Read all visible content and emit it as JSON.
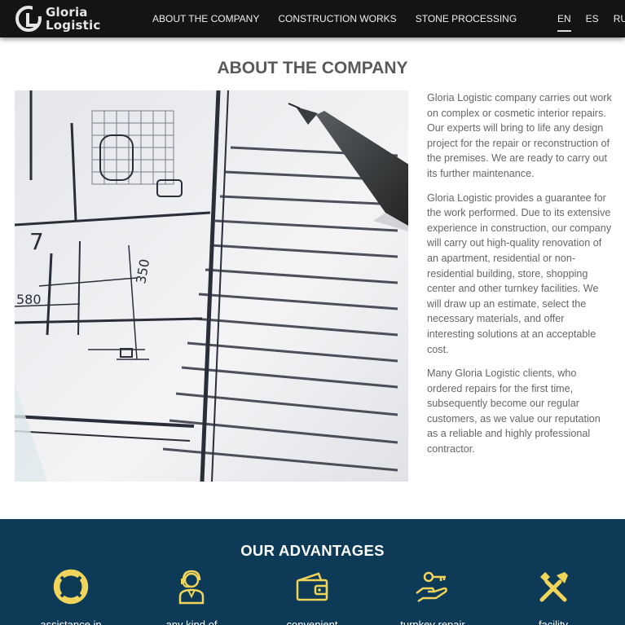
{
  "header": {
    "logo_line1": "Gloria",
    "logo_line2": "Logistic",
    "nav": [
      "ABOUT THE COMPANY",
      "CONSTRUCTION WORKS",
      "STONE PROCESSING"
    ],
    "languages": [
      "EN",
      "ES",
      "RU"
    ],
    "active_language": "EN"
  },
  "about": {
    "title": "ABOUT THE COMPANY",
    "blueprint_labels": [
      "7",
      "350",
      "580"
    ],
    "paragraphs": [
      "Gloria Logistic company carries out work on complex or cosmetic interior repairs. Our experts will bring to life any design project for the repair or reconstruction of the premises. We are ready to carry out its further maintenance.",
      "Gloria Logistic provides a guarantee for the work performed. Due to its extensive experience in construction, our company will carry out high-quality renovation of an apartment, residential or non-residential building, store, shopping center and other turnkey facilities. We will draw up an estimate, select the necessary materials, and offer interesting solutions at an acceptable cost.",
      "Many Gloria Logistic clients, who ordered repairs for the first time, subsequently become our regular customers, as we value our reputation as a reliable and highly professional contractor."
    ]
  },
  "advantages": {
    "title": "OUR ADVANTAGES",
    "icon_color": "#f1d55a",
    "items": [
      {
        "label": "assistance in",
        "icon": "lifebuoy-icon"
      },
      {
        "label": "any kind of",
        "icon": "support-agent-icon"
      },
      {
        "label": "convenient",
        "icon": "wallet-icon"
      },
      {
        "label": "turnkey repair",
        "icon": "key-in-hand-icon"
      },
      {
        "label": "facility",
        "icon": "tools-icon"
      }
    ]
  }
}
